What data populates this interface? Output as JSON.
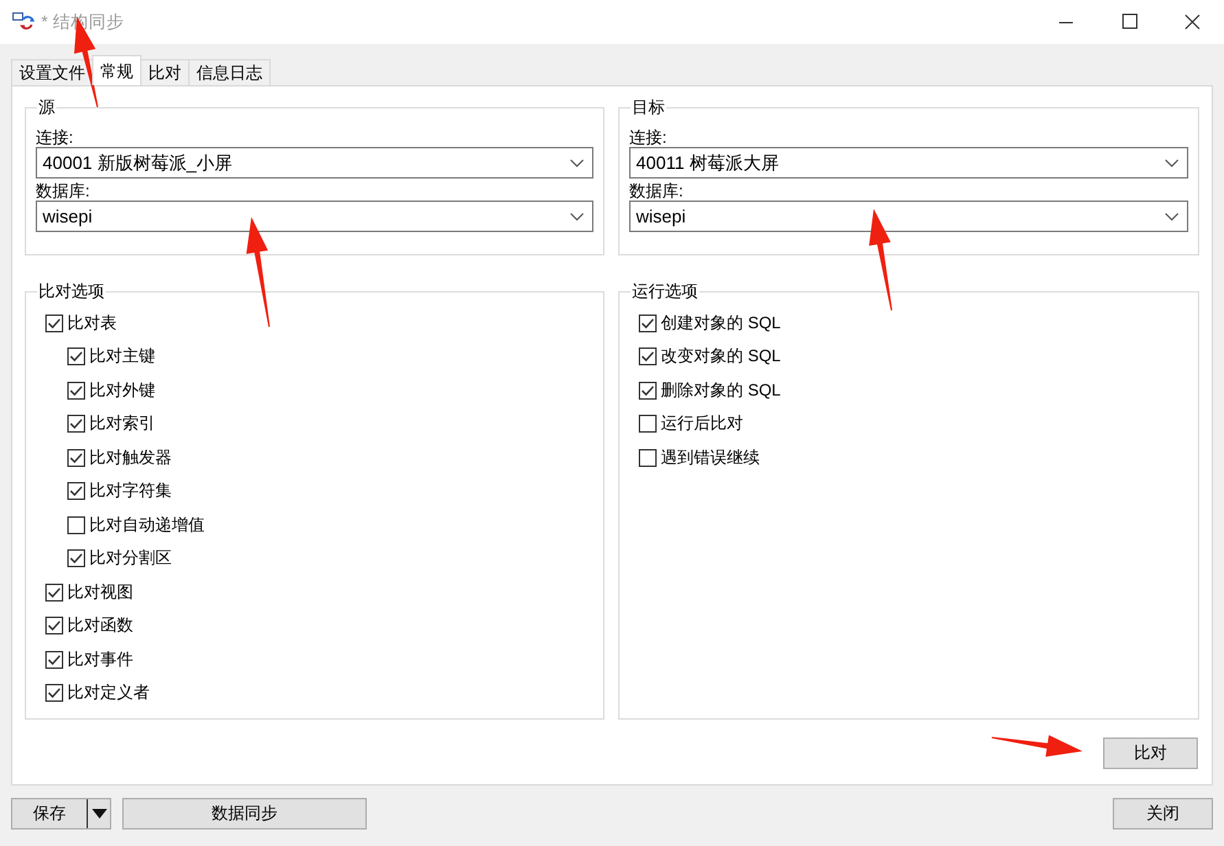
{
  "window": {
    "title": "* 结构同步"
  },
  "tabs": [
    {
      "label": "设置文件",
      "selected": false
    },
    {
      "label": "常规",
      "selected": true
    },
    {
      "label": "比对",
      "selected": false
    },
    {
      "label": "信息日志",
      "selected": false
    }
  ],
  "source": {
    "title": "源",
    "connection_label": "连接:",
    "connection": "40001 新版树莓派_小屏",
    "database_label": "数据库:",
    "database": "wisepi"
  },
  "target": {
    "title": "目标",
    "connection_label": "连接:",
    "connection": "40011 树莓派大屏",
    "database_label": "数据库:",
    "database": "wisepi"
  },
  "compare_options": {
    "title": "比对选项",
    "items": [
      {
        "label": "比对表",
        "checked": true,
        "children": [
          {
            "label": "比对主键",
            "checked": true
          },
          {
            "label": "比对外键",
            "checked": true
          },
          {
            "label": "比对索引",
            "checked": true
          },
          {
            "label": "比对触发器",
            "checked": true
          },
          {
            "label": "比对字符集",
            "checked": true
          },
          {
            "label": "比对自动递增值",
            "checked": false
          },
          {
            "label": "比对分割区",
            "checked": true
          }
        ]
      },
      {
        "label": "比对视图",
        "checked": true
      },
      {
        "label": "比对函数",
        "checked": true
      },
      {
        "label": "比对事件",
        "checked": true
      },
      {
        "label": "比对定义者",
        "checked": true
      }
    ]
  },
  "run_options": {
    "title": "运行选项",
    "items": [
      {
        "label": "创建对象的 SQL",
        "checked": true
      },
      {
        "label": "改变对象的 SQL",
        "checked": true
      },
      {
        "label": "删除对象的 SQL",
        "checked": true
      },
      {
        "label": "运行后比对",
        "checked": false
      },
      {
        "label": "遇到错误继续",
        "checked": false
      }
    ]
  },
  "compare_button": "比对",
  "footer": {
    "save_button": "保存",
    "data_sync_button": "数据同步",
    "close_button": "关闭"
  }
}
